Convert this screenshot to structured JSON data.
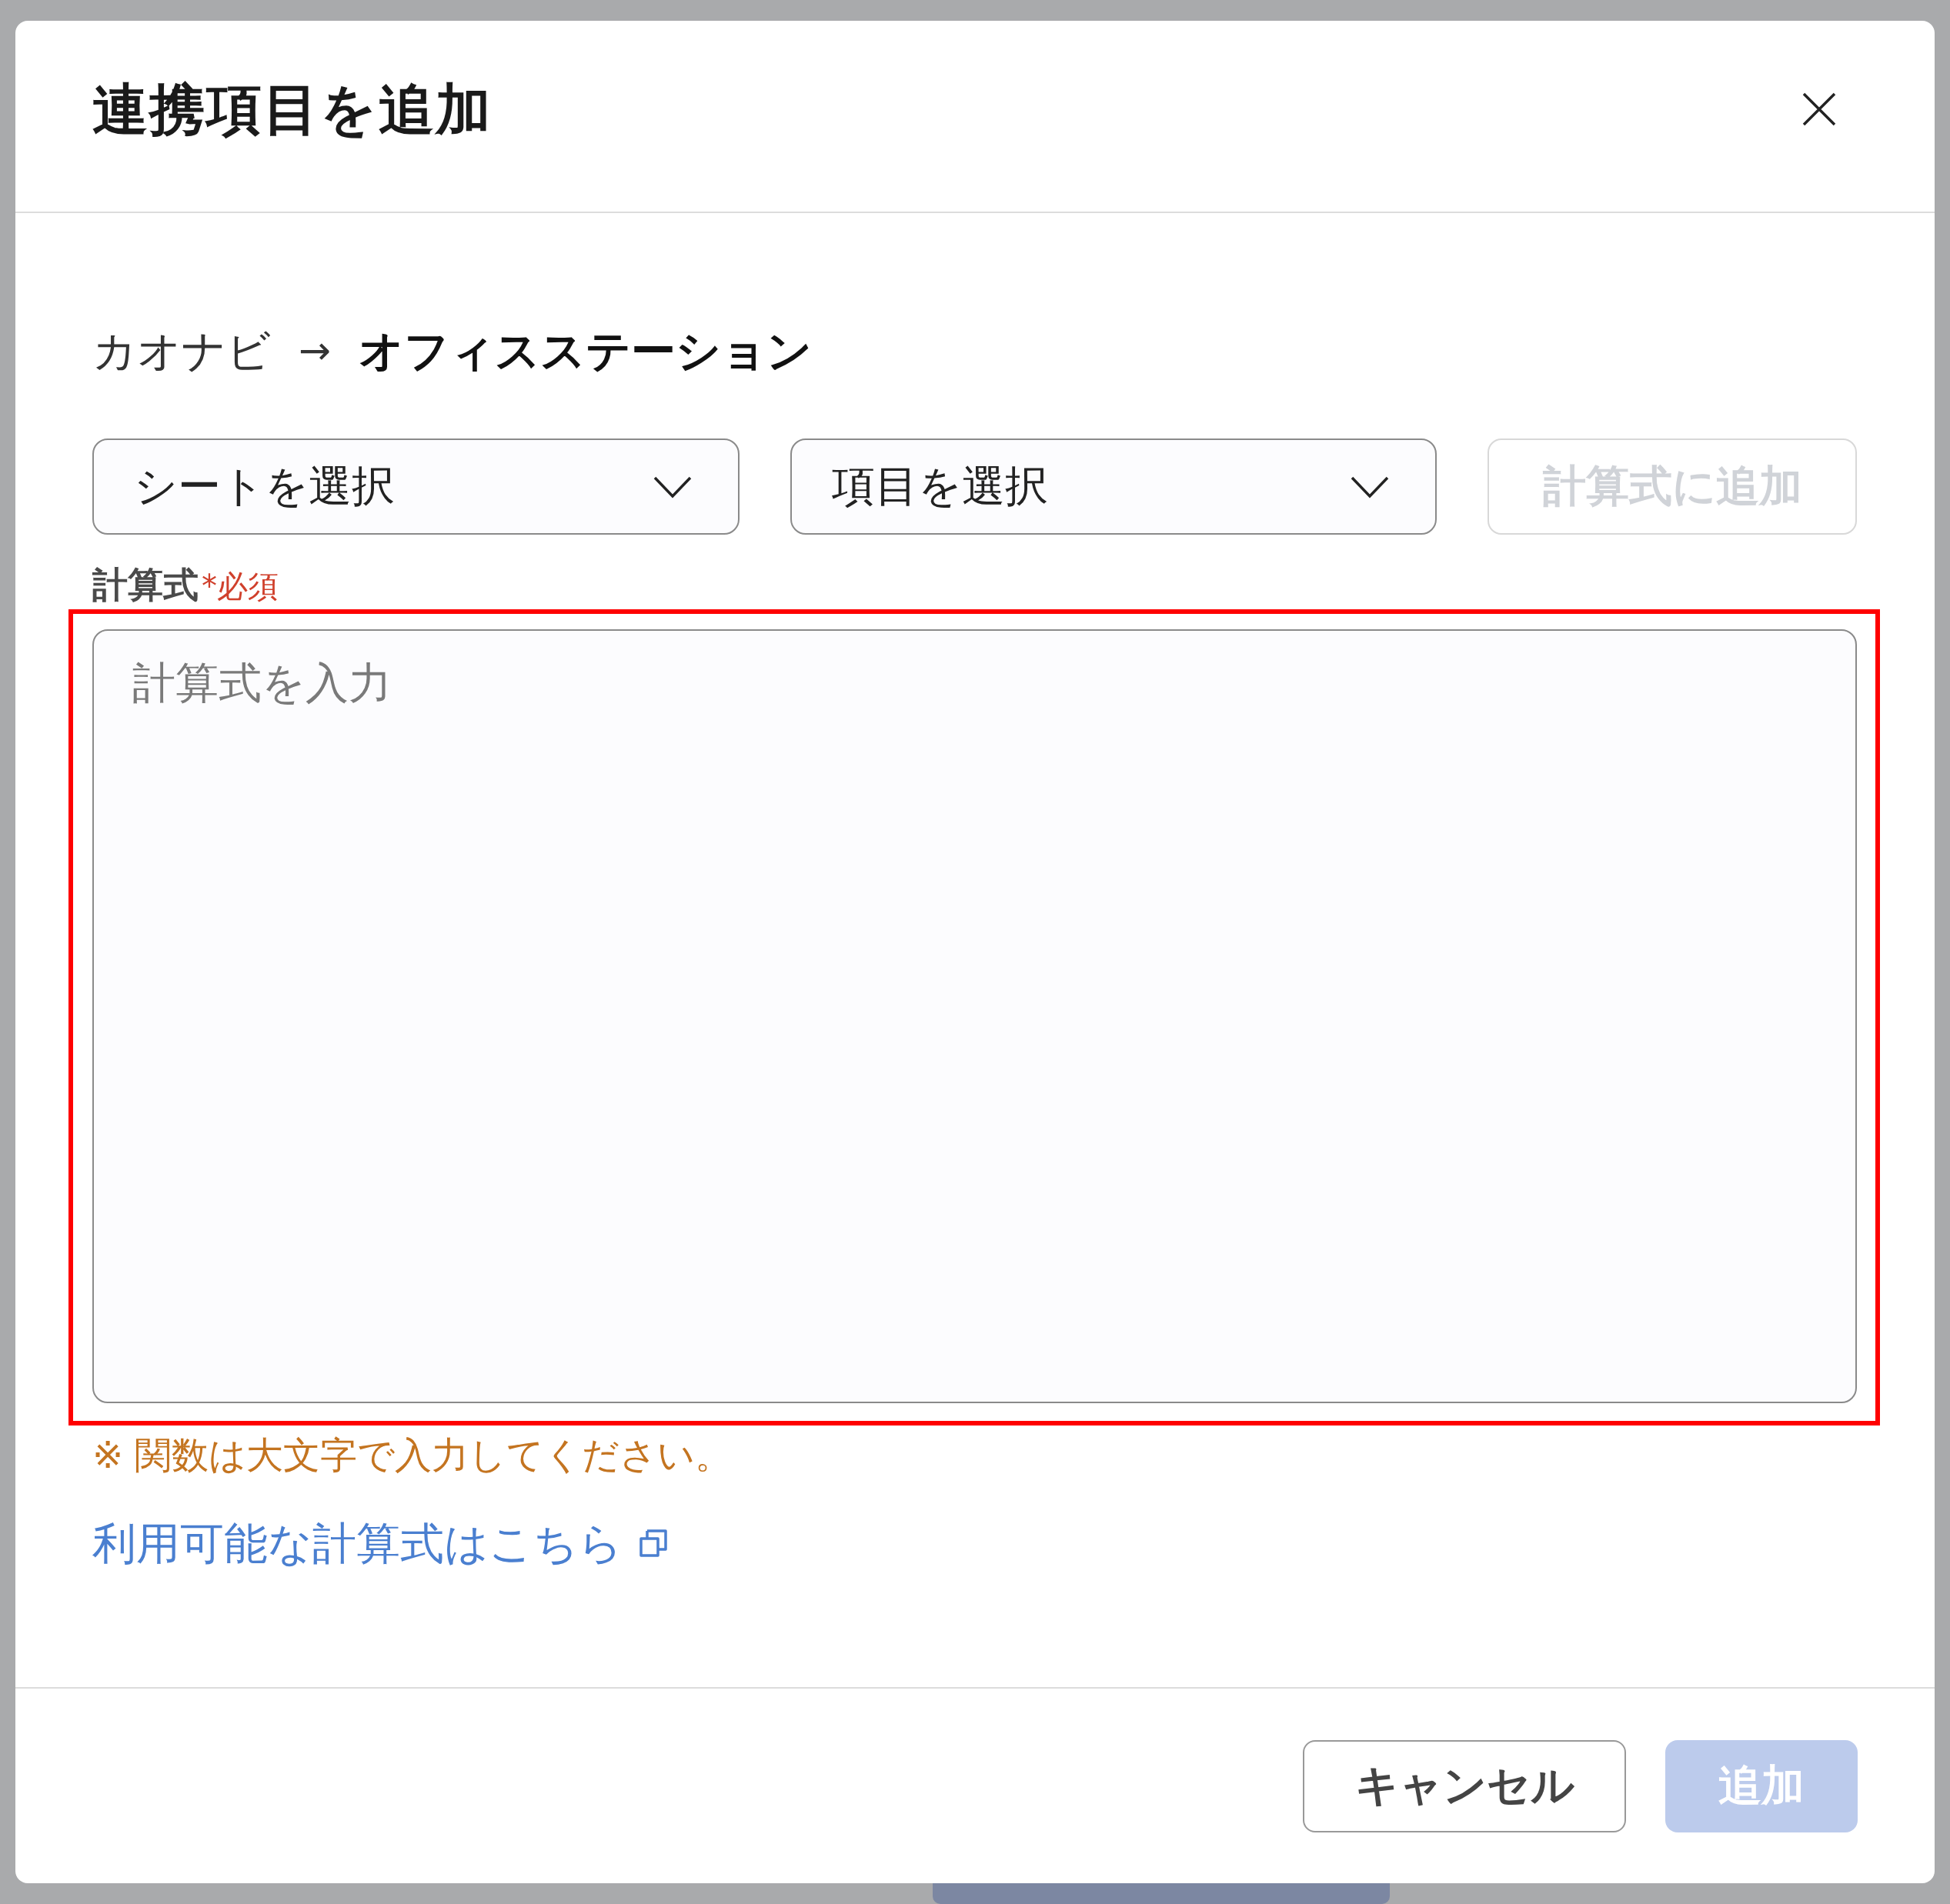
{
  "dialog": {
    "title": "連携項目を追加"
  },
  "mapping": {
    "source": "カオナビ",
    "arrow": "→",
    "target": "オフィスステーション"
  },
  "selectors": [
    {
      "kind": "dropdown",
      "placeholder": "シートを選択"
    },
    {
      "kind": "dropdown",
      "placeholder": "項目を選択"
    },
    {
      "kind": "button",
      "label": "計算式に追加",
      "disabled": true
    }
  ],
  "formula": {
    "label": "計算式",
    "required_mark": "*必須",
    "placeholder": "計算式を入力",
    "highlighted": true,
    "note": "※ 関数は大文字で入力してください。"
  },
  "help_link": {
    "label": "利用可能な計算式はこちら",
    "external": true
  },
  "footer": {
    "buttons": [
      {
        "kind": "secondary",
        "label": "キャンセル",
        "disabled": false
      },
      {
        "kind": "primary",
        "label": "追加",
        "disabled": true
      }
    ]
  }
}
